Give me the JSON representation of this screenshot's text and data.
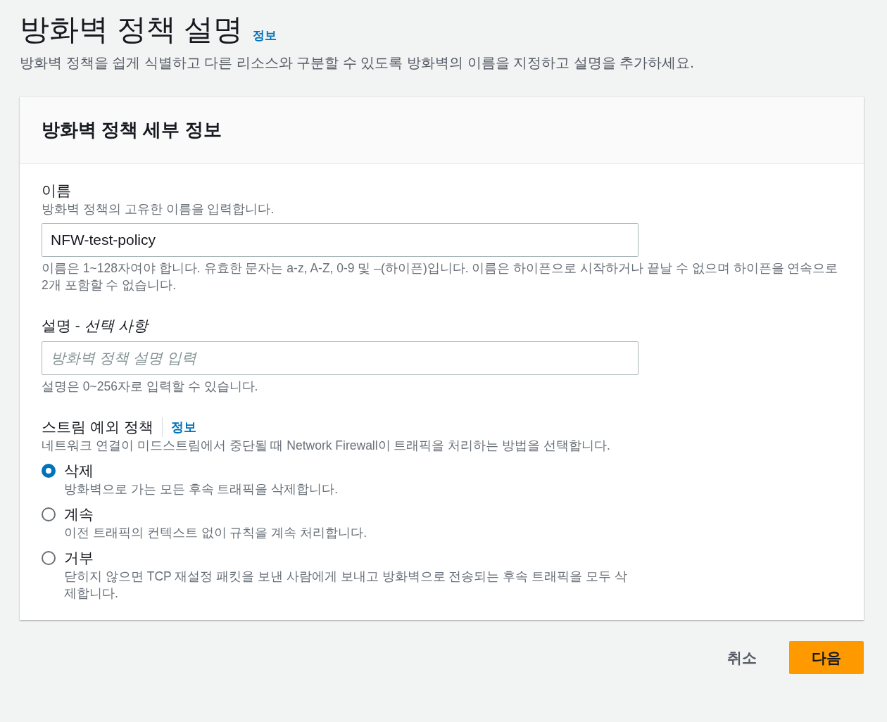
{
  "page": {
    "title": "방화벽 정책 설명",
    "info_link": "정보",
    "description": "방화벽 정책을 쉽게 식별하고 다른 리소스와 구분할 수 있도록 방화벽의 이름을 지정하고 설명을 추가하세요."
  },
  "card": {
    "title": "방화벽 정책 세부 정보",
    "fields": [
      {
        "label": "이름",
        "hint": "방화벽 정책의 고유한 이름을 입력합니다.",
        "value": "NFW-test-policy",
        "constraint": "이름은 1~128자여야 합니다. 유효한 문자는 a-z, A-Z, 0-9 및 –(하이픈)입니다. 이름은 하이픈으로 시작하거나 끝날 수 없으며 하이픈을 연속으로 2개 포함할 수 없습니다."
      },
      {
        "label": "설명 - *선택 사항*",
        "placeholder": "방화벽 정책 설명 입력",
        "constraint": "설명은 0~256자로 입력할 수 있습니다."
      }
    ],
    "stream_exception": {
      "label": "스트림 예외 정책",
      "info_link": "정보",
      "description": "네트워크 연결이 미드스트림에서 중단될 때 Network Firewall이 트래픽을 처리하는 방법을 선택합니다.",
      "options": [
        {
          "label": "삭제",
          "description": "방화벽으로 가는 모든 후속 트래픽을 삭제합니다.",
          "selected": true
        },
        {
          "label": "계속",
          "description": "이전 트래픽의 컨텍스트 없이 규칙을 계속 처리합니다.",
          "selected": false
        },
        {
          "label": "거부",
          "description": "닫히지 않으면 TCP 재설정 패킷을 보낸 사람에게 보내고 방화벽으로 전송되는 후속 트래픽을 모두 삭제합니다.",
          "selected": false
        }
      ]
    }
  },
  "buttons": [
    {
      "label": "취소",
      "kind": "link"
    },
    {
      "label": "다음",
      "kind": "primary"
    }
  ]
}
